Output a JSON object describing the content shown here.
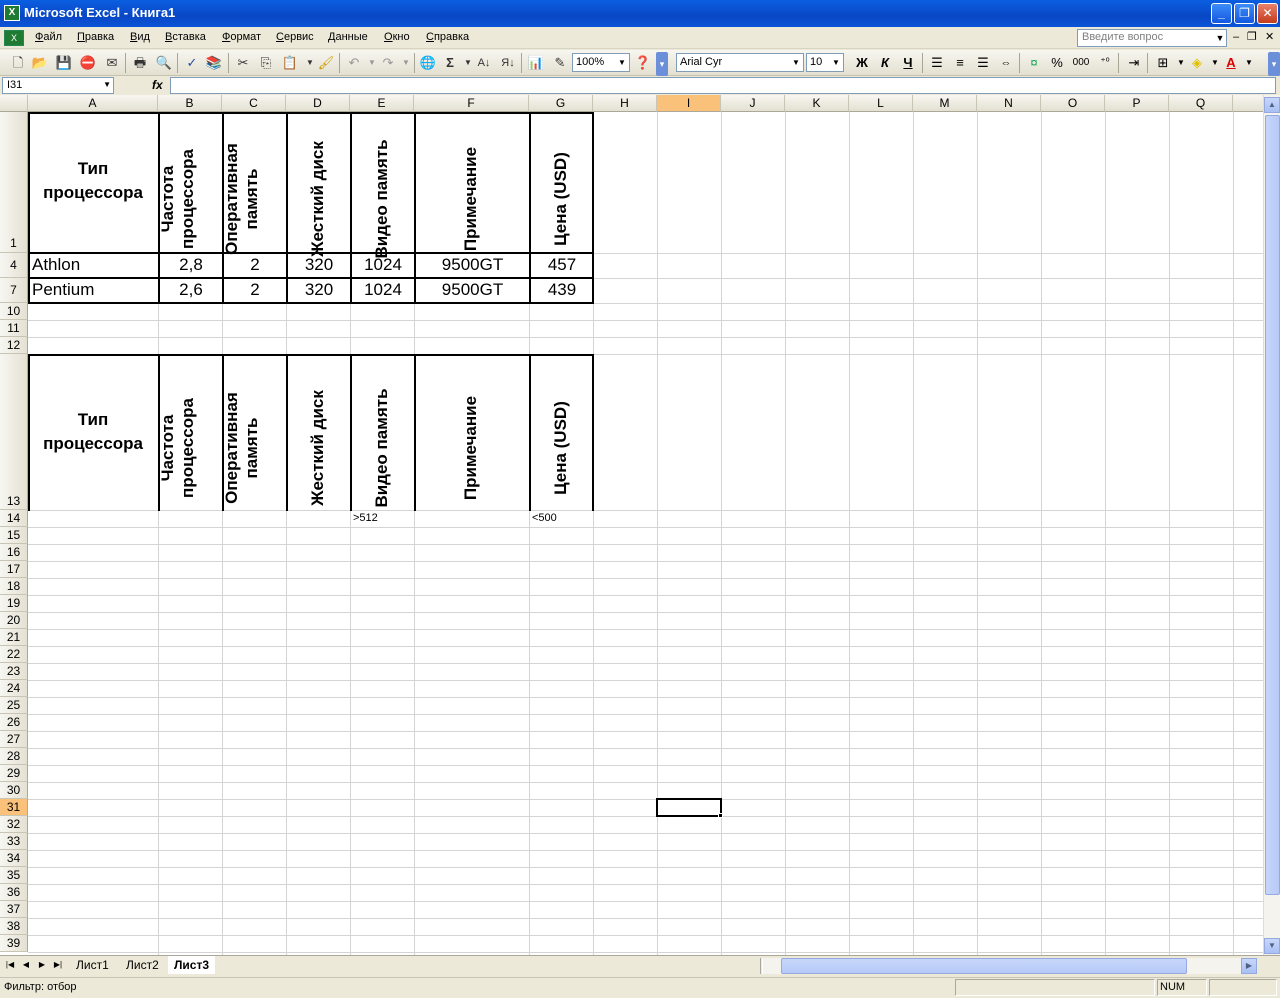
{
  "window": {
    "title": "Microsoft Excel - Книга1",
    "app_icon": "excel-icon"
  },
  "menu": [
    "Файл",
    "Правка",
    "Вид",
    "Вставка",
    "Формат",
    "Сервис",
    "Данные",
    "Окно",
    "Справка"
  ],
  "help_placeholder": "Введите вопрос",
  "toolbar": {
    "zoom": "100%",
    "font": "Arial Cyr",
    "font_size": "10",
    "bold": "Ж",
    "italic": "К",
    "underline": "Ч",
    "percent": "%",
    "thousands": "000"
  },
  "formula_bar": {
    "name_box": "I31",
    "fx": "fx",
    "content": ""
  },
  "columns": [
    "A",
    "B",
    "C",
    "D",
    "E",
    "F",
    "G",
    "H",
    "I",
    "J",
    "K",
    "L",
    "M",
    "N",
    "O",
    "P",
    "Q"
  ],
  "rows": [
    "1",
    "4",
    "7",
    "10",
    "11",
    "12",
    "13",
    "14",
    "15",
    "16",
    "17",
    "18",
    "19",
    "20",
    "21",
    "22",
    "23",
    "24",
    "25",
    "26",
    "27",
    "28",
    "29",
    "30",
    "31",
    "32",
    "33",
    "34",
    "35",
    "36",
    "37",
    "38",
    "39"
  ],
  "selected": {
    "column": "I",
    "row": "31"
  },
  "headers": [
    "Тип процессора",
    "Частота процессора",
    "Оперативная память",
    "Жесткий диск",
    "Видео память",
    "Примечание",
    "Цена (USD)"
  ],
  "table_rows": [
    [
      "Athlon",
      "2,8",
      "2",
      "320",
      "1024",
      "9500GT",
      "457"
    ],
    [
      "Pentium",
      "2,6",
      "2",
      "320",
      "1024",
      "9500GT",
      "439"
    ]
  ],
  "criteria": {
    "video_memory": ">512",
    "price": "<500"
  },
  "sheets": [
    "Лист1",
    "Лист2",
    "Лист3"
  ],
  "active_sheet": "Лист3",
  "status": {
    "text": "Фильтр: отбор",
    "num": "NUM"
  }
}
